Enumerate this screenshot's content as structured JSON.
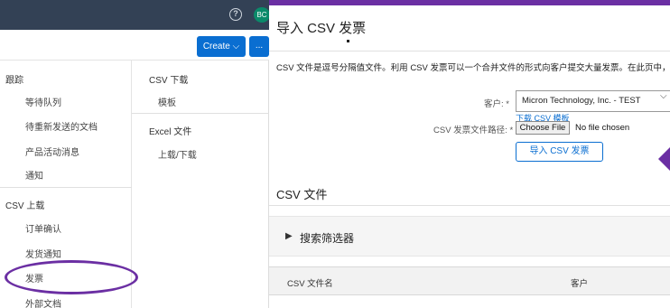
{
  "colors": {
    "topbar": "#334155",
    "accent": "#0a6ed1",
    "highlight": "#6b2fa3",
    "avatar": "#0b8a6a"
  },
  "topbar": {
    "help_icon": "?",
    "avatar_initials": "BC"
  },
  "actions": {
    "create_label": "Create ⌵",
    "more_label": "..."
  },
  "nav": {
    "tracking_header": "跟踪",
    "tracking_items": [
      "等待队列",
      "待重新发送的文档",
      "产品活动消息",
      "通知"
    ],
    "csv_upload_header": "CSV 上载",
    "csv_upload_items": [
      "订单确认",
      "发货通知",
      "发票",
      "外部文档"
    ],
    "csv_download_header": "CSV 下载",
    "csv_download_items": [
      "模板"
    ],
    "excel_header": "Excel 文件",
    "excel_items": [
      "上载/下载"
    ]
  },
  "main": {
    "title": "导入 CSV 发票",
    "description": "CSV 文件是逗号分隔值文件。利用 CSV 发票可以一个合并文件的形式向客户提交大量发票。在此页中，",
    "customer_label": "客户: *",
    "customer_value": "Micron Technology, Inc. - TEST",
    "download_template_link": "下载 CSV 模板",
    "path_label": "CSV 发票文件路径: *",
    "choose_file_label": "Choose File",
    "no_file_text": "No file chosen",
    "import_button": "导入 CSV 发票",
    "csv_files_title": "CSV 文件",
    "search_filter_label": "搜索筛选器",
    "table_headers": [
      "CSV 文件名",
      "客户"
    ]
  }
}
